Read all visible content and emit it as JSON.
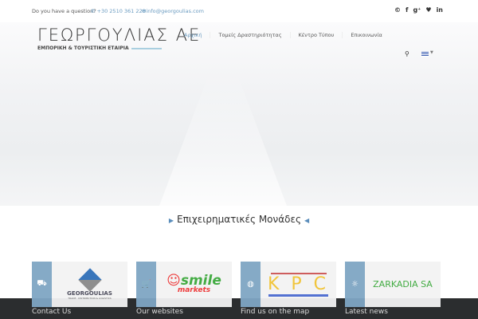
{
  "topbar": {
    "question": "Do you have a question?",
    "phone": "+30 2510 361 220",
    "email": "info@georgoulias.com"
  },
  "social": [
    "skype",
    "f",
    "g+",
    "twitter",
    "in"
  ],
  "logo": {
    "title": "ΓΕΩΡΓΟΥΛΙΑΣ ΑΕ",
    "subtitle": "ΕΜΠΟΡΙΚΗ & ΤΟΥΡΙΣΤΙΚΗ ΕΤΑΙΡΙΑ"
  },
  "nav": [
    "Αρχική",
    "Τομείς Δραστηριότητας",
    "Κέντρο Τύπου",
    "Επικοινωνία"
  ],
  "section_title": "Επιχειρηματικές Μονάδες",
  "cards": [
    {
      "icon": "truck-icon",
      "logo": "GEORGOULIAS",
      "sub": "TRADE · DISTRIBUTION & LOGISTICS"
    },
    {
      "icon": "cart-icon",
      "logo": "smile",
      "sub": "markets"
    },
    {
      "icon": "globe-icon",
      "logo": "K P C"
    },
    {
      "icon": "sun-icon",
      "logo": "ZARKADIA SA"
    }
  ],
  "footer": [
    "Contact Us",
    "Our websites",
    "Find us on the map",
    "Latest news"
  ],
  "colors": {
    "accent": "#7fa6c4",
    "footer": "#2b2d2f"
  }
}
